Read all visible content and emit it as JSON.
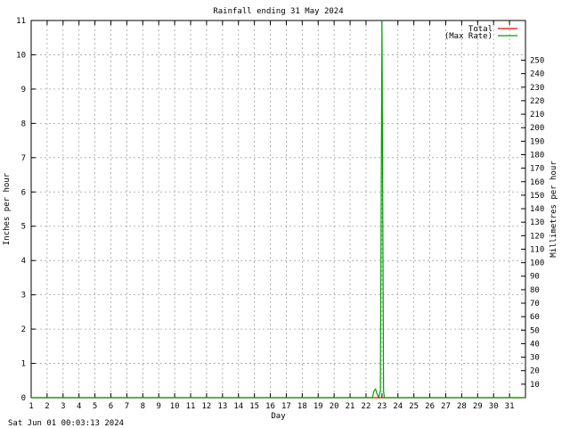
{
  "footer_timestamp": "Sat Jun 01 00:03:13 2024",
  "chart_data": {
    "type": "line",
    "title": "Rainfall ending 31 May 2024",
    "xlabel": "Day",
    "ylabel": "Inches per hour",
    "y2label": "Millimetres per hour",
    "xlim": [
      1,
      32
    ],
    "ylim": [
      0,
      11
    ],
    "y2lim": [
      0,
      279.4
    ],
    "x_ticks": [
      1,
      2,
      3,
      4,
      5,
      6,
      7,
      8,
      9,
      10,
      11,
      12,
      13,
      14,
      15,
      16,
      17,
      18,
      19,
      20,
      21,
      22,
      23,
      24,
      25,
      26,
      27,
      28,
      29,
      30,
      31
    ],
    "y_ticks": [
      0,
      1,
      2,
      3,
      4,
      5,
      6,
      7,
      8,
      9,
      10,
      11
    ],
    "y2_ticks": [
      10,
      20,
      30,
      40,
      50,
      60,
      70,
      80,
      90,
      100,
      110,
      120,
      130,
      140,
      150,
      160,
      170,
      180,
      190,
      200,
      210,
      220,
      230,
      240,
      250
    ],
    "grid": true,
    "legend_position": "top-right",
    "series": [
      {
        "name": "Total",
        "color": "#ff0000",
        "x": [
          1,
          32
        ],
        "y": [
          0,
          0
        ]
      },
      {
        "name": "(Max Rate)",
        "color": "#00a000",
        "x": [
          1,
          22.4,
          22.5,
          22.6,
          22.7,
          22.8,
          22.9,
          22.95,
          23.0,
          23.05,
          23.1,
          23.15,
          23.2,
          32
        ],
        "y": [
          0,
          0,
          0.2,
          0.25,
          0.1,
          0,
          0.2,
          5.5,
          11,
          5.6,
          0.2,
          0,
          0,
          0
        ]
      }
    ]
  }
}
